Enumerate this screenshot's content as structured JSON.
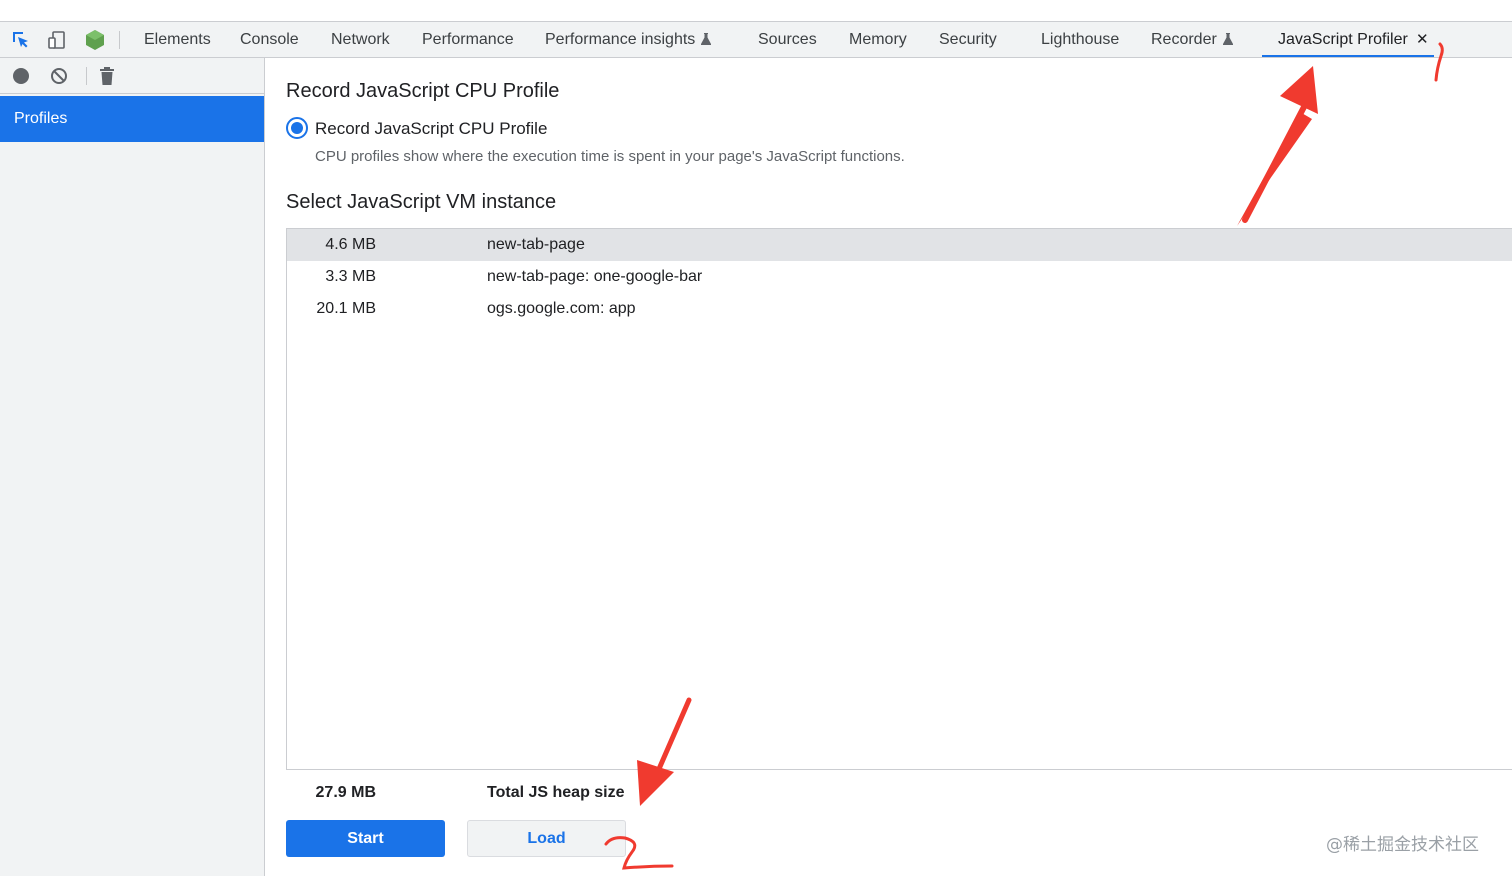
{
  "tabs": [
    {
      "label": "Elements"
    },
    {
      "label": "Console"
    },
    {
      "label": "Network"
    },
    {
      "label": "Performance"
    },
    {
      "label": "Performance insights",
      "experimental": true
    },
    {
      "label": "Sources"
    },
    {
      "label": "Memory"
    },
    {
      "label": "Security"
    },
    {
      "label": "Lighthouse"
    },
    {
      "label": "Recorder",
      "experimental": true
    },
    {
      "label": "JavaScript Profiler",
      "active": true,
      "closable": true
    }
  ],
  "toolbar_icons": [
    "inspect-element-icon",
    "device-toolbar-icon",
    "node-js-icon"
  ],
  "sidebar": {
    "toolbar_icons": [
      "record-icon",
      "clear-icon",
      "delete-icon"
    ],
    "items": [
      {
        "label": "Profiles",
        "selected": true
      }
    ]
  },
  "main": {
    "section_title": "Record JavaScript CPU Profile",
    "radio_label": "Record JavaScript CPU Profile",
    "radio_checked": true,
    "description": "CPU profiles show where the execution time is spent in your page's JavaScript functions.",
    "vm_title": "Select JavaScript VM instance",
    "vm_instances": [
      {
        "size": "4.6 MB",
        "name": "new-tab-page",
        "selected": true
      },
      {
        "size": "3.3 MB",
        "name": "new-tab-page: one-google-bar"
      },
      {
        "size": "20.1 MB",
        "name": "ogs.google.com: app"
      }
    ],
    "total_size": "27.9 MB",
    "total_label": "Total JS heap size",
    "start_label": "Start",
    "load_label": "Load"
  },
  "watermark": "@稀土掘金技术社区",
  "annotations": {
    "mark_1": "1",
    "mark_2": "2",
    "color": "#f03a2f"
  },
  "colors": {
    "accent": "#1a73e8",
    "toolbar_bg": "#f1f3f4",
    "selected_row": "#e1e3e6"
  }
}
